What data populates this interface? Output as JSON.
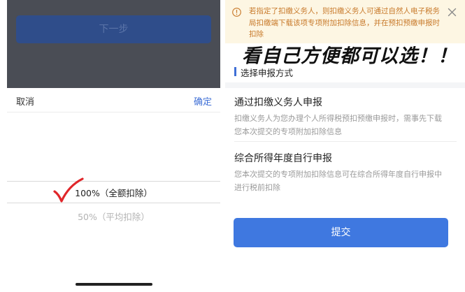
{
  "left_panel": {
    "next_button_label": "下一步",
    "cancel_label": "取消",
    "confirm_label": "确定",
    "options": [
      {
        "label": "100%（全额扣除）",
        "selected": true
      },
      {
        "label": "50%（平均扣除）",
        "selected": false
      }
    ]
  },
  "right_panel": {
    "notice_text": "若指定了扣缴义务人，则扣缴义务人可通过自然人电子税务局扣缴端下载该项专项附加扣除信息，并在预扣预缴申报时扣除",
    "overlay_caption": "看自己方便都可以选！！",
    "section_title": "选择申报方式",
    "options": [
      {
        "title": "通过扣缴义务人申报",
        "desc": "扣缴义务人为您办理个人所得税预扣预缴申报时，需事先下载您本次提交的专项附加扣除信息"
      },
      {
        "title": "综合所得年度自行申报",
        "desc": "您本次提交的专项附加扣除信息可在综合所得年度自行申报中进行税前扣除"
      }
    ],
    "submit_label": "提交"
  },
  "colors": {
    "accent_blue": "#3f78e0",
    "notice_bg": "#fdf6e3",
    "notice_text": "#c8792a",
    "check_red": "#e0262a"
  },
  "icons": [
    "warning-icon",
    "close-icon",
    "checkmark-annotation"
  ]
}
